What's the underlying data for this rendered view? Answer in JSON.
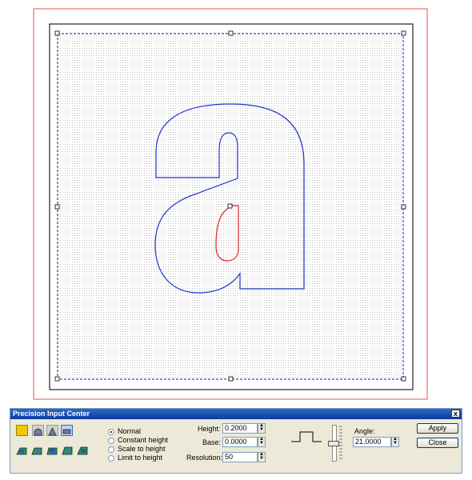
{
  "panel": {
    "title": "Precision Input Center",
    "close_symbol": "x"
  },
  "toolbar_icons": [
    "square-icon",
    "dome-icon",
    "arch-icon",
    "flat-icon"
  ],
  "bevel_icons": [
    "bevel-1-icon",
    "bevel-2-icon",
    "bevel-3-icon",
    "bevel-4-icon",
    "bevel-5-icon"
  ],
  "modes": [
    {
      "label": "Normal",
      "selected": true
    },
    {
      "label": "Constant height",
      "selected": false
    },
    {
      "label": "Scale to height",
      "selected": false
    },
    {
      "label": "Limit to height",
      "selected": false
    }
  ],
  "fields": {
    "height_label": "Height:",
    "height_value": "0.2000",
    "base_label": "Base:",
    "base_value": "0.0000",
    "resolution_label": "Resolution:",
    "resolution_value": "50",
    "angle_label": "Angle:",
    "angle_value": "21.0000"
  },
  "buttons": {
    "apply": "Apply",
    "close": "Close"
  },
  "colors": {
    "outer_frame": "#e05050",
    "inner_frame": "#222222",
    "selection": "#1a1aa0",
    "glyph_outline": "#2233cc",
    "inner_contour": "#dd2222",
    "grid": "#cccccc"
  }
}
